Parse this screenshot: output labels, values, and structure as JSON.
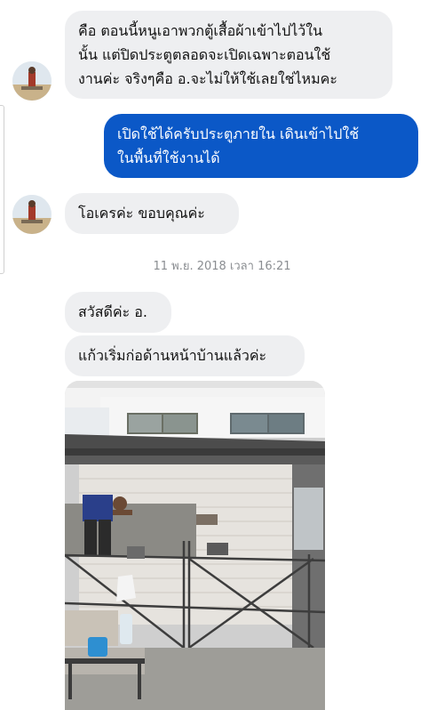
{
  "messages": [
    {
      "text": "คือ ตอนนี้หนูเอาพวกตู้เสื้อผ้าเข้าไปไว้ใน\nนั้น แต่ปิดประตูตลอดจะเปิดเฉพาะตอนใช้\nงานค่ะ จริงๆคือ อ.จะไม่ให้ใช้เลยใช่ไหมคะ"
    },
    {
      "text": "เปิดใช้ได้ครับประตูภายใน เดินเข้าไปใช้\nในพื้นที่ใช้งานได้"
    },
    {
      "text": "โอเครค่ะ ขอบคุณค่ะ"
    },
    {
      "text": "สวัสดีค่ะ อ."
    },
    {
      "text": "แก้วเริ่มก่อด้านหน้าบ้านแล้วค่ะ"
    }
  ],
  "timestamp": "11 พ.ย. 2018 เวลา 16:21",
  "colors": {
    "outgoing": "#0b58c7",
    "incoming": "#eeeff1",
    "timestamp": "#8a8d91"
  }
}
